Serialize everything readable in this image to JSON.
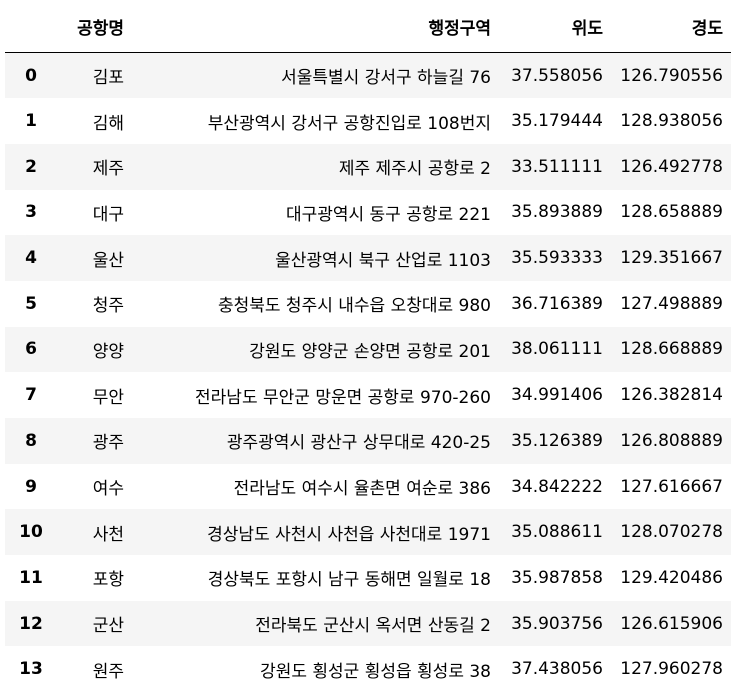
{
  "table": {
    "columns": [
      "",
      "공항명",
      "행정구역",
      "위도",
      "경도"
    ],
    "rows": [
      {
        "index": "0",
        "name": "김포",
        "address": "서울특별시 강서구 하늘길 76",
        "lat": "37.558056",
        "lng": "126.790556"
      },
      {
        "index": "1",
        "name": "김해",
        "address": "부산광역시 강서구 공항진입로 108번지",
        "lat": "35.179444",
        "lng": "128.938056"
      },
      {
        "index": "2",
        "name": "제주",
        "address": "제주 제주시 공항로 2",
        "lat": "33.511111",
        "lng": "126.492778"
      },
      {
        "index": "3",
        "name": "대구",
        "address": "대구광역시 동구 공항로 221",
        "lat": "35.893889",
        "lng": "128.658889"
      },
      {
        "index": "4",
        "name": "울산",
        "address": "울산광역시 북구 산업로 1103",
        "lat": "35.593333",
        "lng": "129.351667"
      },
      {
        "index": "5",
        "name": "청주",
        "address": "충청북도 청주시 내수읍 오창대로 980",
        "lat": "36.716389",
        "lng": "127.498889"
      },
      {
        "index": "6",
        "name": "양양",
        "address": "강원도 양양군 손양면 공항로 201",
        "lat": "38.061111",
        "lng": "128.668889"
      },
      {
        "index": "7",
        "name": "무안",
        "address": "전라남도 무안군 망운면 공항로 970-260",
        "lat": "34.991406",
        "lng": "126.382814"
      },
      {
        "index": "8",
        "name": "광주",
        "address": "광주광역시 광산구 상무대로 420-25",
        "lat": "35.126389",
        "lng": "126.808889"
      },
      {
        "index": "9",
        "name": "여수",
        "address": "전라남도 여수시 율촌면 여순로 386",
        "lat": "34.842222",
        "lng": "127.616667"
      },
      {
        "index": "10",
        "name": "사천",
        "address": "경상남도 사천시 사천읍 사천대로 1971",
        "lat": "35.088611",
        "lng": "128.070278"
      },
      {
        "index": "11",
        "name": "포항",
        "address": "경상북도 포항시 남구 동해면 일월로 18",
        "lat": "35.987858",
        "lng": "129.420486"
      },
      {
        "index": "12",
        "name": "군산",
        "address": "전라북도 군산시 옥서면 산동길 2",
        "lat": "35.903756",
        "lng": "126.615906"
      },
      {
        "index": "13",
        "name": "원주",
        "address": "강원도 횡성군 횡성읍 횡성로 38",
        "lat": "37.438056",
        "lng": "127.960278"
      }
    ]
  }
}
